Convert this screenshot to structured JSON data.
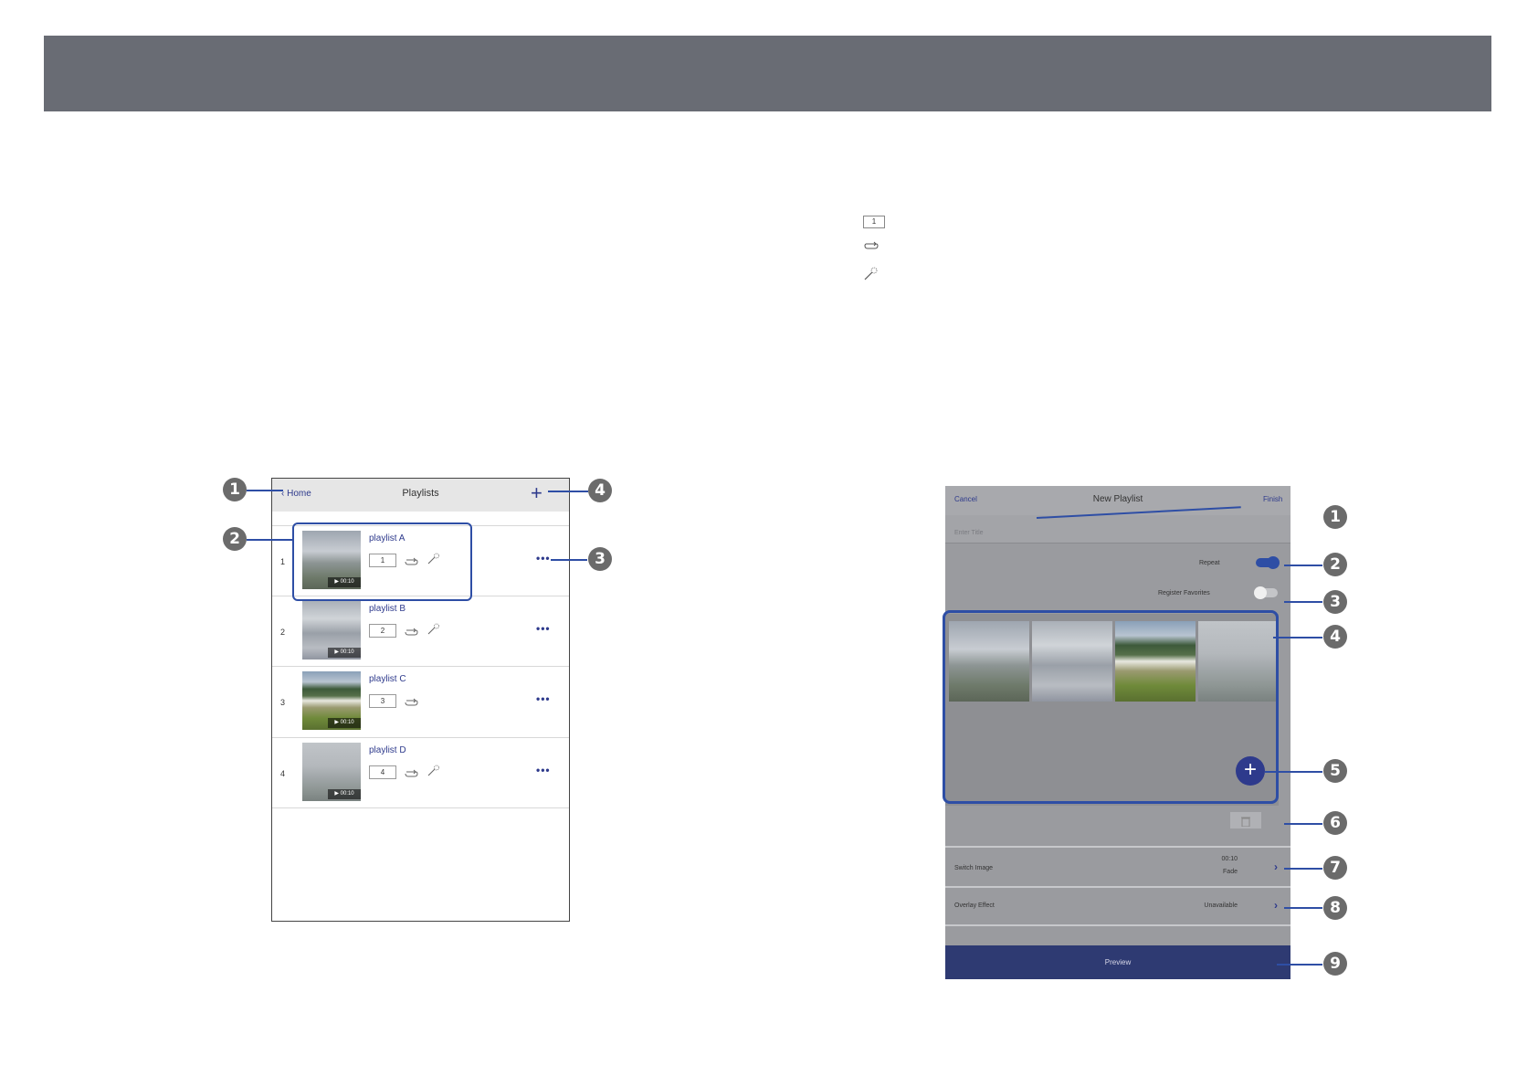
{
  "playlists_screen": {
    "back_label": "Home",
    "title": "Playlists",
    "add_icon": "plus-icon",
    "items": [
      {
        "number": "1",
        "name": "playlist A",
        "badge": "1",
        "duration": "00:10",
        "repeat": true,
        "effect": true
      },
      {
        "number": "2",
        "name": "playlist B",
        "badge": "2",
        "duration": "00:10",
        "repeat": true,
        "effect": true
      },
      {
        "number": "3",
        "name": "playlist C",
        "badge": "3",
        "duration": "00:10",
        "repeat": true,
        "effect": false
      },
      {
        "number": "4",
        "name": "playlist D",
        "badge": "4",
        "duration": "00:10",
        "repeat": true,
        "effect": true
      }
    ]
  },
  "legend": {
    "badge_example": "1",
    "icons": [
      "number-badge-icon",
      "repeat-icon",
      "effect-wand-icon"
    ]
  },
  "new_playlist_screen": {
    "cancel_label": "Cancel",
    "title": "New Playlist",
    "finish_label": "Finish",
    "title_placeholder": "Enter Title",
    "repeat_label": "Repeat",
    "repeat_on": true,
    "register_favorites_label": "Register Favorites",
    "register_favorites_on": false,
    "switch_image_label": "Switch Image",
    "switch_image_time": "00:10",
    "switch_image_effect": "Fade",
    "overlay_effect_label": "Overlay Effect",
    "overlay_effect_value": "Unavailable",
    "preview_label": "Preview"
  },
  "callouts": {
    "left": [
      "1",
      "2",
      "3",
      "4"
    ],
    "right": [
      "1",
      "2",
      "3",
      "4",
      "5",
      "6",
      "7",
      "8",
      "9"
    ]
  },
  "colors": {
    "header_bar": "#696c74",
    "accent": "#2e4ea5",
    "callout": "#6b6b6b"
  }
}
